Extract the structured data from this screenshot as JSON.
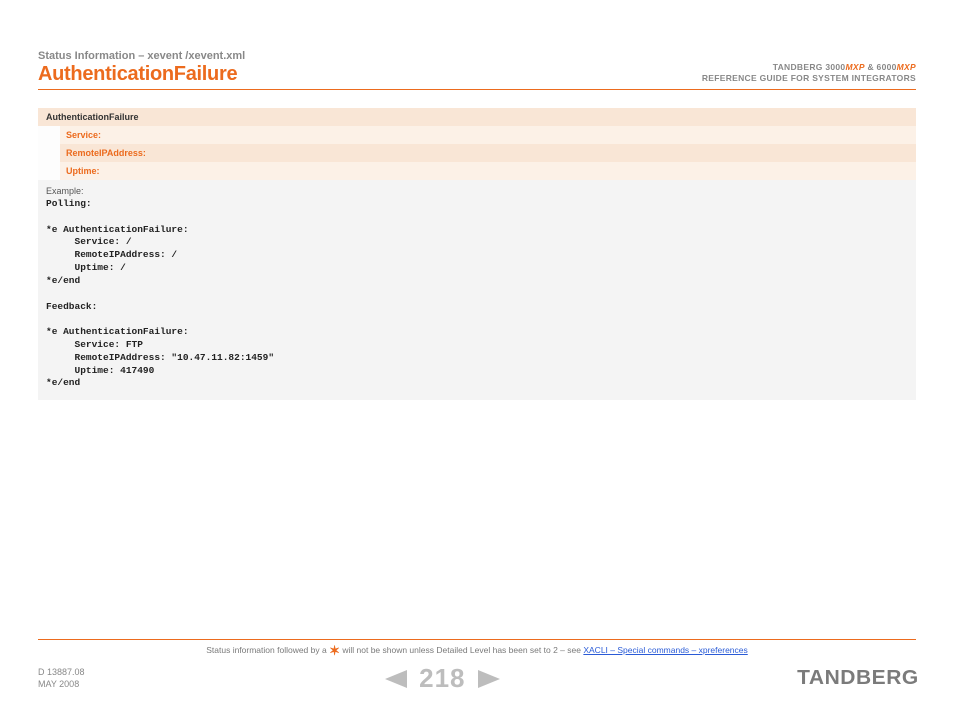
{
  "breadcrumb": "Status Information – xevent /xevent.xml",
  "title": "AuthenticationFailure",
  "header_right": {
    "line1_pre": "TANDBERG 3000",
    "mxp1": "MXP",
    "line1_mid": " & 6000",
    "mxp2": "MXP",
    "line2": "REFERENCE GUIDE FOR SYSTEM INTEGRATORS"
  },
  "rows": {
    "head": "AuthenticationFailure",
    "sub1": "Service:",
    "sub2": "RemoteIPAddress:",
    "sub3": "Uptime:"
  },
  "example_label": "Example:",
  "code": "Polling:\n\n*e AuthenticationFailure:\n     Service: /\n     RemoteIPAddress: /\n     Uptime: /\n*e/end\n\nFeedback:\n\n*e AuthenticationFailure:\n     Service: FTP\n     RemoteIPAddress: \"10.47.11.82:1459\"\n     Uptime: 417490\n*e/end",
  "footnote": {
    "pre": "Status information followed by a ",
    "post": " will not be shown unless Detailed Level has been set to 2 – see ",
    "link": "XACLI – Special commands – xpreferences"
  },
  "docinfo": {
    "line1": "D 13887.08",
    "line2": "MAY 2008"
  },
  "page_number": "218",
  "brand": "TANDBERG"
}
